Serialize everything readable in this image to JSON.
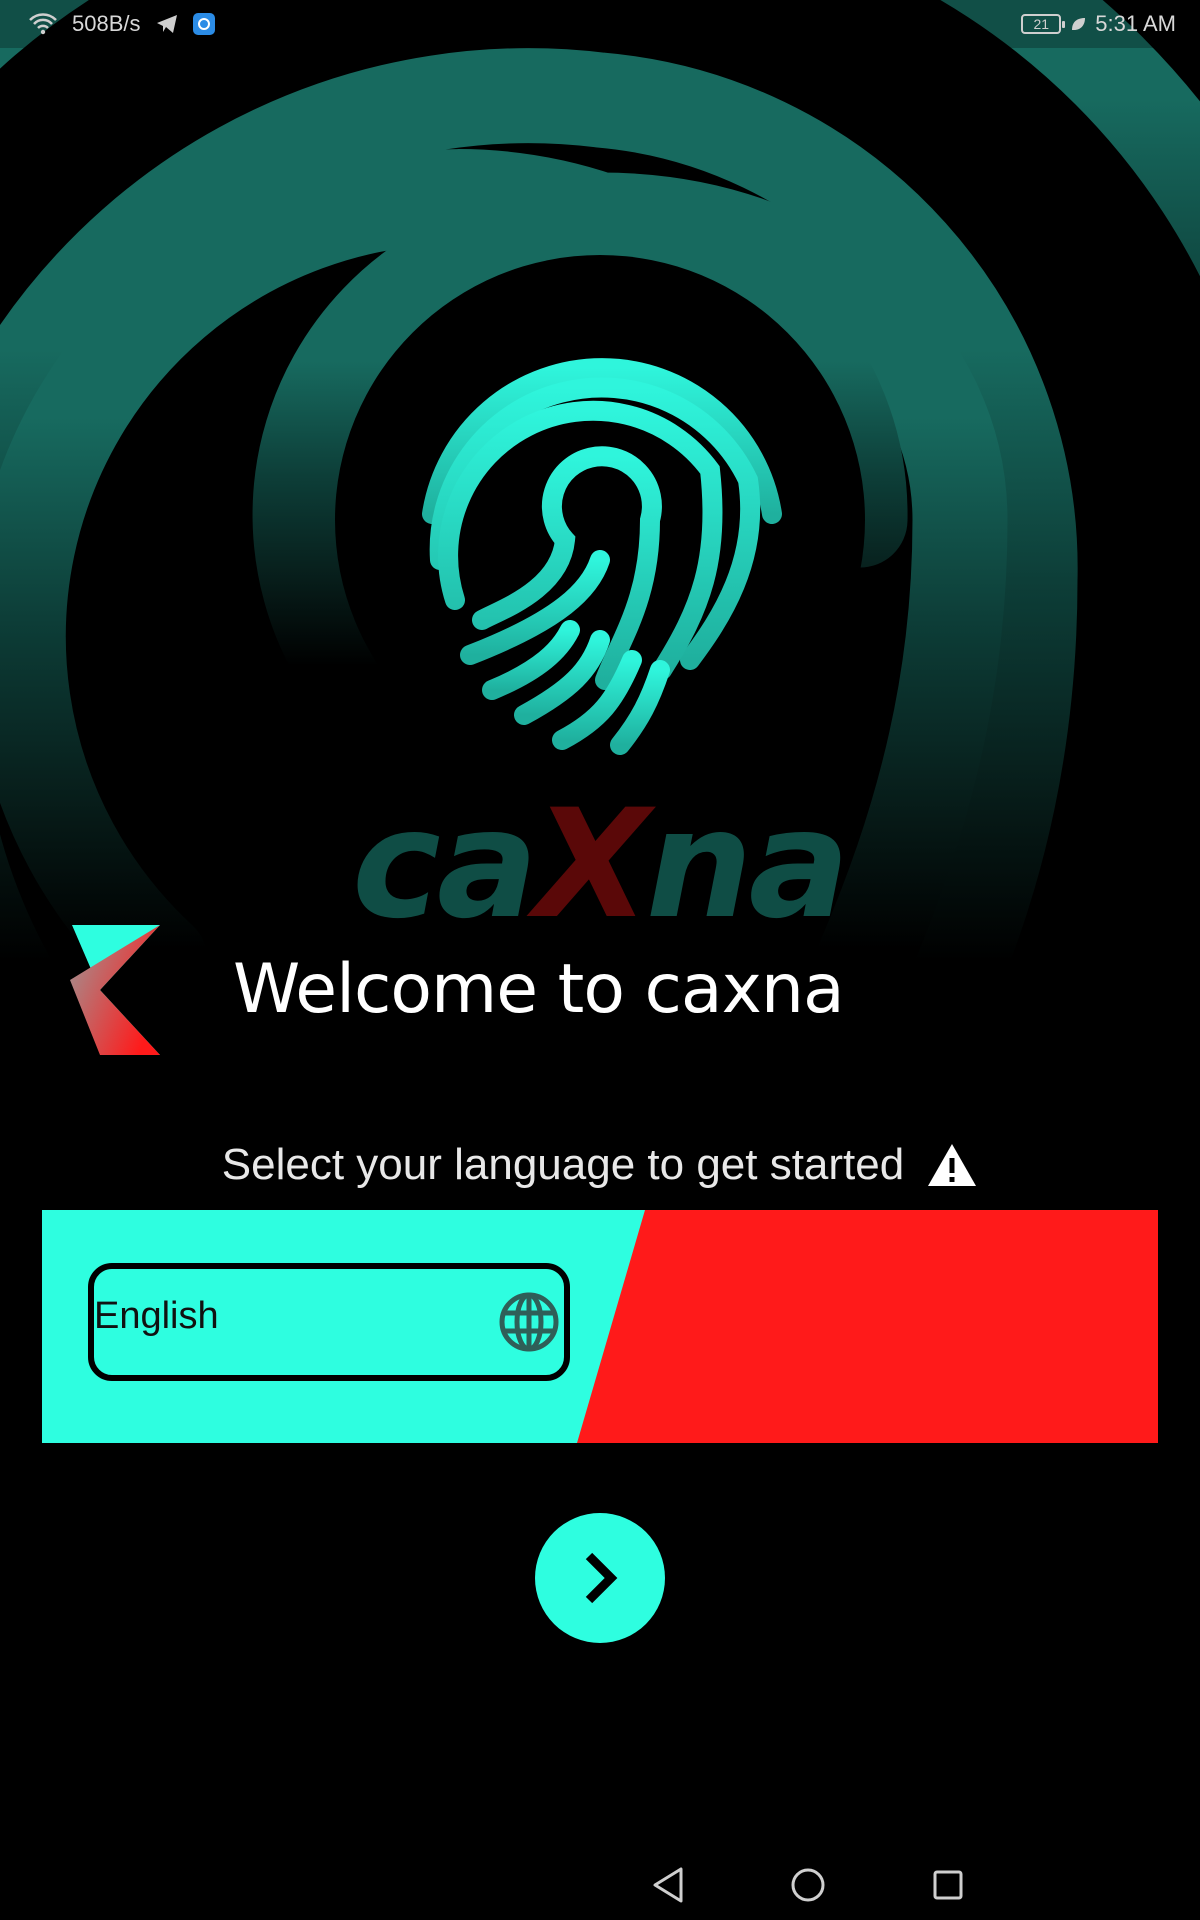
{
  "status_bar": {
    "network_speed": "508B/s",
    "battery_level": "21",
    "time": "5:31 AM",
    "icons": [
      "wifi-icon",
      "telegram-icon",
      "app-notification-icon",
      "battery-icon",
      "battery-saver-leaf-icon"
    ]
  },
  "brand": {
    "logo_part1": "ca",
    "logo_x": "X",
    "logo_part2": "na"
  },
  "welcome": {
    "title": "Welcome to caxna"
  },
  "language_prompt": {
    "text": "Select your language to get started",
    "icon": "warning-icon"
  },
  "language_select": {
    "value": "English",
    "icon": "globe-icon"
  },
  "next_button": {
    "icon": "chevron-right-icon"
  },
  "nav_bar": {
    "buttons": [
      "back-icon",
      "home-icon",
      "recents-icon"
    ]
  },
  "colors": {
    "accent": "#2efee0",
    "danger": "#ff1a1a",
    "background": "#000000",
    "fingerprint_bg": "#176a5f"
  }
}
